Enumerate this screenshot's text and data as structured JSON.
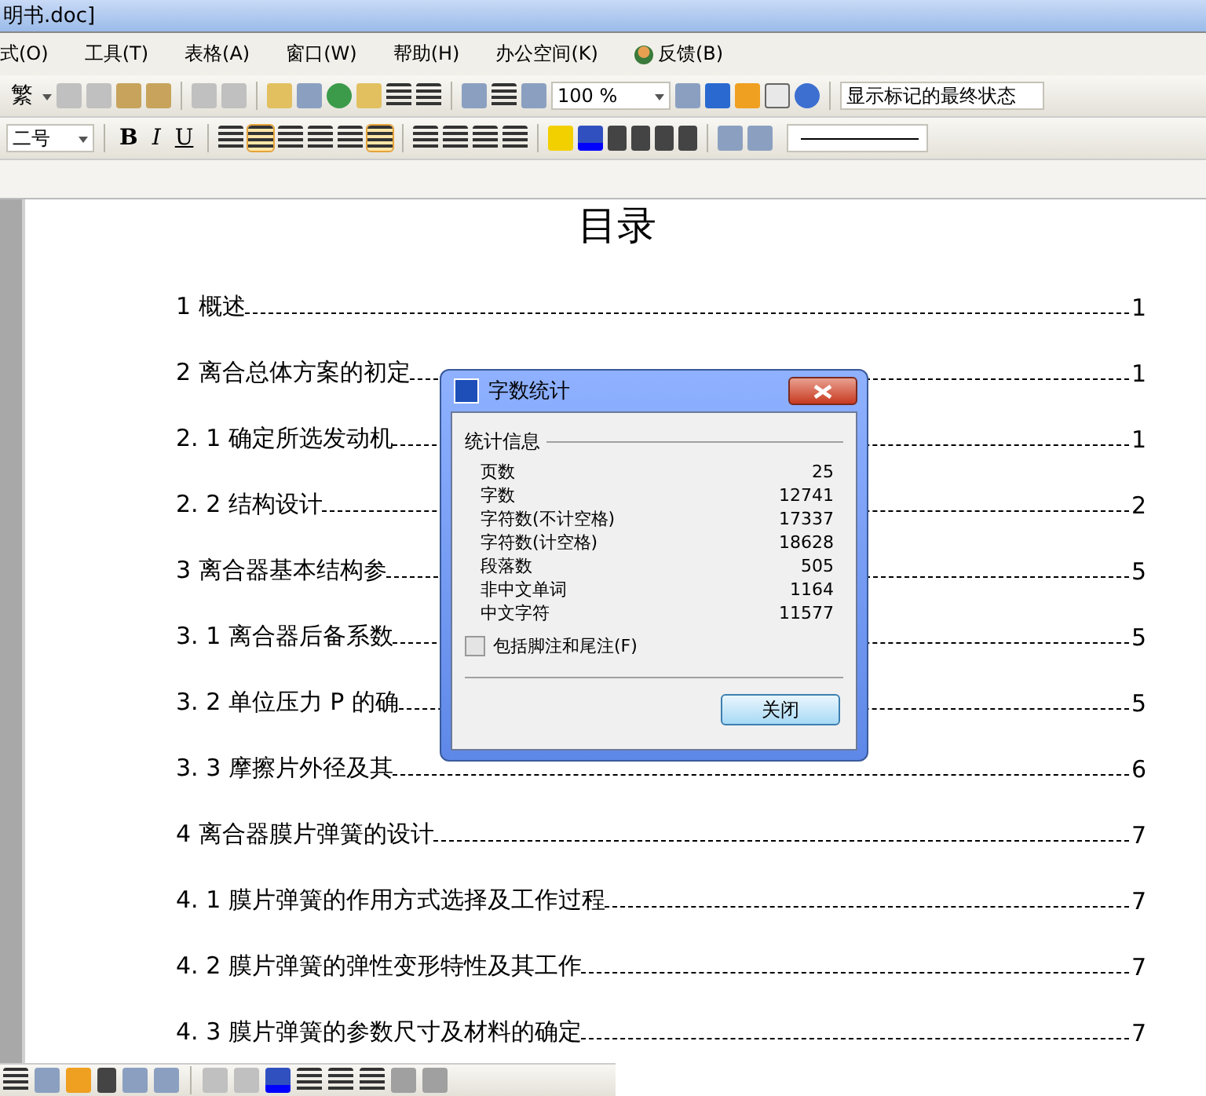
{
  "window": {
    "title": "明书.doc]"
  },
  "menu": [
    "式(O)",
    "工具(T)",
    "表格(A)",
    "窗口(W)",
    "帮助(H)",
    "办公空间(K)",
    "反馈(B)"
  ],
  "toolbar": {
    "traditional": "繁",
    "zoom": "100 %",
    "markup_mode": "显示标记的最终状态"
  },
  "format_bar": {
    "font_size": "二号",
    "bold": "B",
    "italic": "I",
    "underline": "U"
  },
  "document": {
    "title": "目录",
    "toc": [
      {
        "text": "1 概述",
        "page": "1"
      },
      {
        "text": "2  离合总体方案的初定",
        "page": "1"
      },
      {
        "text": "2. 1 确定所选发动机",
        "page": "1"
      },
      {
        "text": "2. 2 结构设计",
        "page": "2"
      },
      {
        "text": "3  离合器基本结构参",
        "page": "5"
      },
      {
        "text": "3. 1 离合器后备系数",
        "page": "5"
      },
      {
        "text": "3. 2 单位压力 P 的确",
        "page": "5"
      },
      {
        "text": "3. 3  摩擦片外径及其",
        "page": "6"
      },
      {
        "text": "4  离合器膜片弹簧的设计",
        "page": "7"
      },
      {
        "text": "4. 1  膜片弹簧的作用方式选择及工作过程",
        "page": "7"
      },
      {
        "text": "4. 2 膜片弹簧的弹性变形特性及其工作",
        "page": "7"
      },
      {
        "text": "4. 3  膜片弹簧的参数尺寸及材料的确定",
        "page": "7"
      }
    ]
  },
  "dialog": {
    "title": "字数统计",
    "group": "统计信息",
    "stats": [
      {
        "label": "页数",
        "value": "25"
      },
      {
        "label": "字数",
        "value": "12741"
      },
      {
        "label": "字符数(不计空格)",
        "value": "17337"
      },
      {
        "label": "字符数(计空格)",
        "value": "18628"
      },
      {
        "label": "段落数",
        "value": "505"
      },
      {
        "label": "非中文单词",
        "value": "1164"
      },
      {
        "label": "中文字符",
        "value": "11577"
      }
    ],
    "include_footnotes": {
      "label": "包括脚注和尾注(F)",
      "checked": false
    },
    "close_button": "关闭"
  }
}
